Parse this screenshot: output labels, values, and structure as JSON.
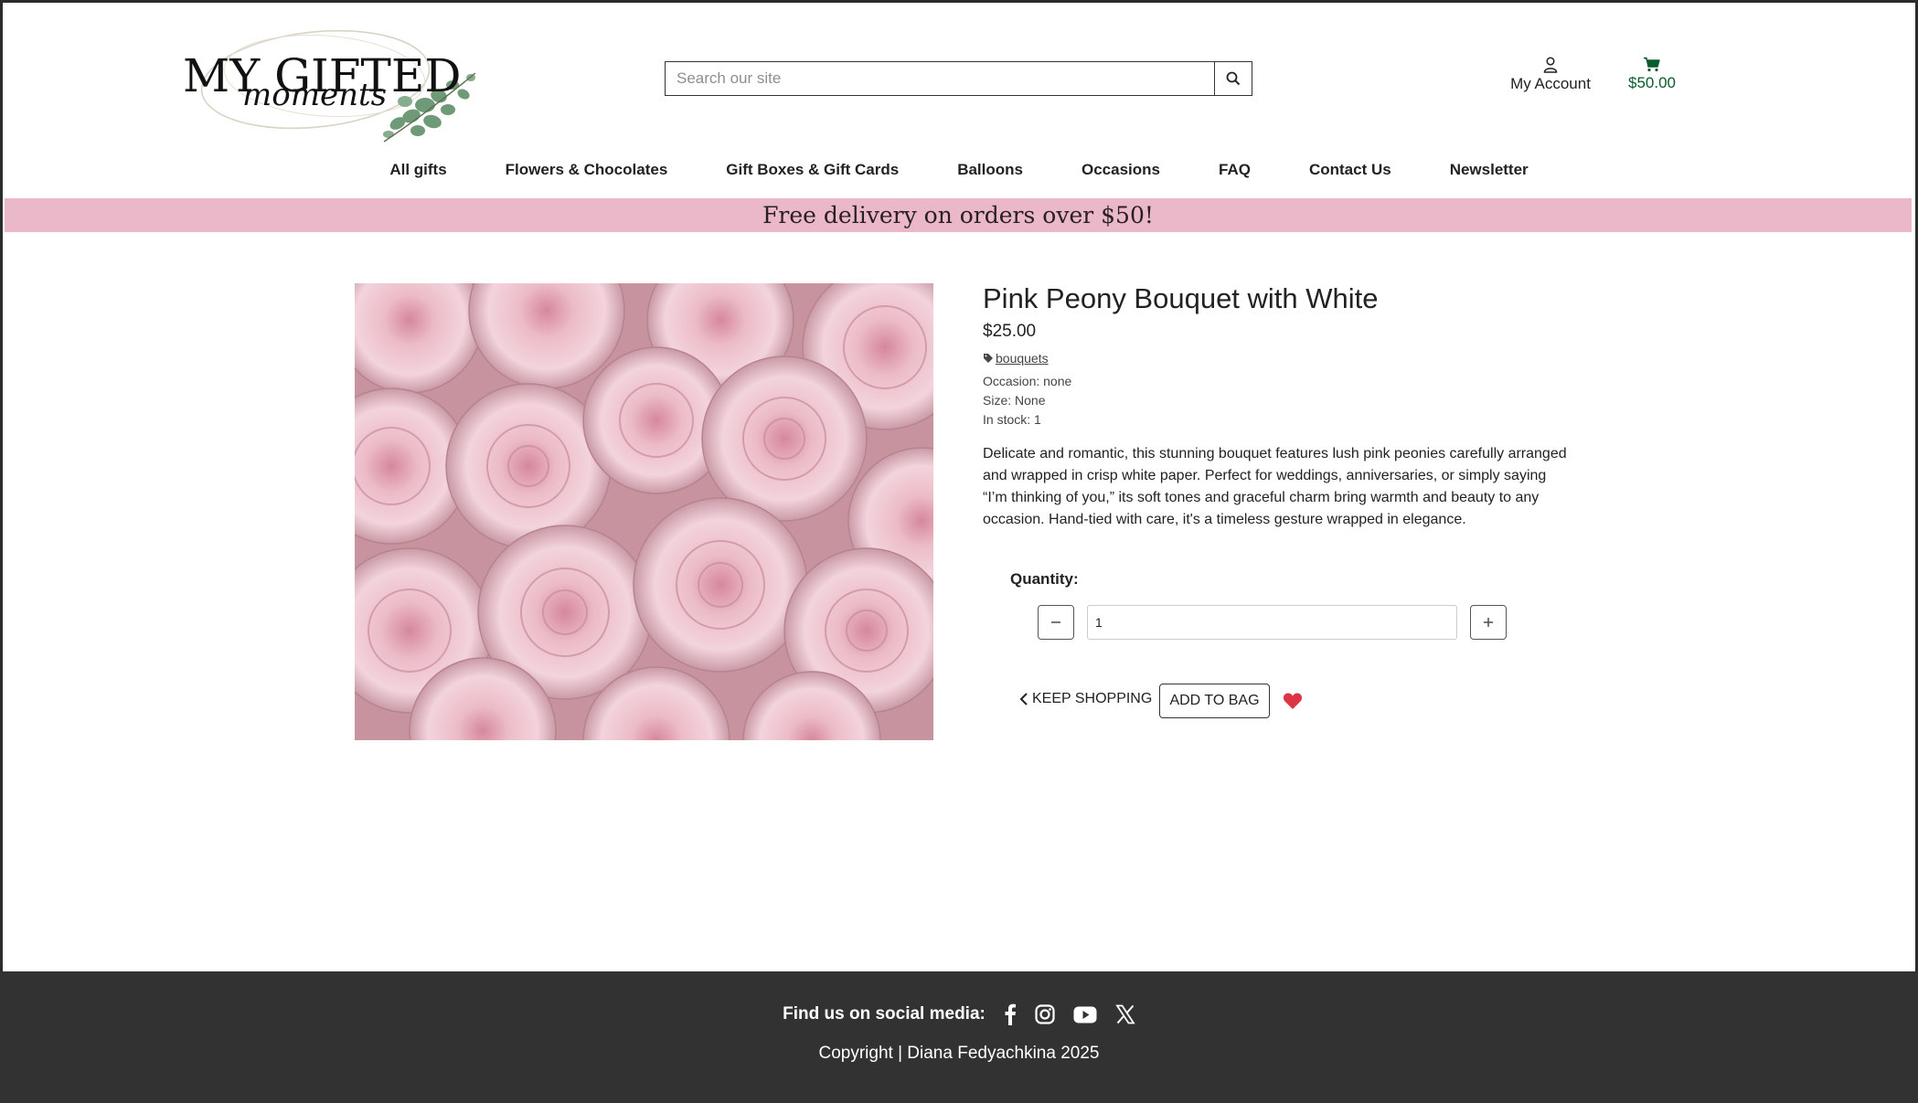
{
  "brand": {
    "logo_line1": "MY GIFTED",
    "logo_line2": "moments"
  },
  "search": {
    "placeholder": "Search our site",
    "value": ""
  },
  "account": {
    "label": "My Account"
  },
  "cart": {
    "total": "$50.00"
  },
  "nav": {
    "items": [
      "All gifts",
      "Flowers & Chocolates",
      "Gift Boxes & Gift Cards",
      "Balloons",
      "Occasions",
      "FAQ",
      "Contact Us",
      "Newsletter"
    ]
  },
  "banner": {
    "text": "Free delivery on orders over $50!"
  },
  "product": {
    "title": "Pink Peony Bouquet with White",
    "price": "$25.00",
    "tag": "bouquets",
    "occasion": "Occasion: none",
    "size": "Size: None",
    "stock": "In stock: 1",
    "description": "Delicate and romantic, this stunning bouquet features lush pink peonies carefully arranged and wrapped in crisp white paper. Perfect for weddings, anniversaries, or simply saying “I’m thinking of you,” its soft tones and graceful charm bring warmth and beauty to any occasion. Hand-tied with care, it's a timeless gesture wrapped in elegance.",
    "quantity_label": "Quantity:",
    "quantity_value": "1",
    "keep_shopping": "KEEP SHOPPING",
    "add_to_bag": "ADD TO BAG"
  },
  "footer": {
    "social_label": "Find us on social media:",
    "copyright": "Copyright | Diana Fedyachkina 2025"
  },
  "colors": {
    "banner_bg": "#ebb8c9",
    "footer_bg": "#333232",
    "cart_green": "#0a5c2a",
    "heart_red": "#dc3545"
  }
}
